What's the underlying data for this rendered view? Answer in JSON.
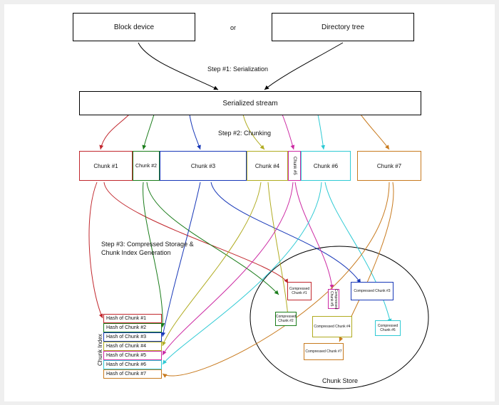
{
  "top": {
    "block": "Block device",
    "or": "or",
    "dir": "Directory tree"
  },
  "steps": {
    "s1": "Step #1: Serialization",
    "s2": "Step #2: Chunking",
    "s3a": "Step #3: Compressed Storage &",
    "s3b": "Chunk Index Generation"
  },
  "serialized": "Serialized stream",
  "chunks": {
    "c1": "Chunk #1",
    "c2": "Chunk #2",
    "c3": "Chunk #3",
    "c4": "Chunk #4",
    "c5": "Chunk #5",
    "c6": "Chunk #6",
    "c7": "Chunk #7"
  },
  "compressed": {
    "c1": "Compressed Chunk #1",
    "c2": "Compressed Chunk #2",
    "c3": "Compressed Chunk #3",
    "c4": "Compressed Chunk #4",
    "c5": "Compressed Chunk #5",
    "c6": "Compressed Chunk #6",
    "c7": "Compressed Chunk #7"
  },
  "hashes": {
    "h1": "Hash of Chunk #1",
    "h2": "Hash of Chunk #2",
    "h3": "Hash of Chunk #3",
    "h4": "Hash of Chunk #4",
    "h5": "Hash of Chunk #5",
    "h6": "Hash of Chunk #6",
    "h7": "Hash of Chunk #7"
  },
  "index_label": "Chunk Index",
  "store_label": "Chunk Store",
  "colors": {
    "c1": "#c1272d",
    "c2": "#1a7c1a",
    "c3": "#1838b8",
    "c4": "#b0ab20",
    "c5": "#cc2aa3",
    "c6": "#2fcad4",
    "c7": "#c87a1e"
  }
}
